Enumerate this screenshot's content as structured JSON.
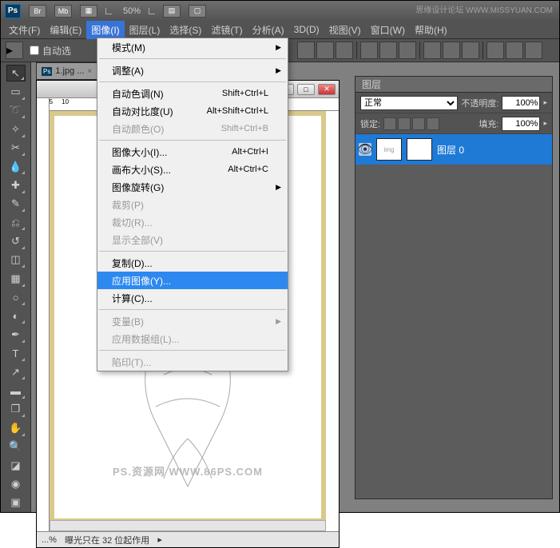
{
  "app": {
    "icon": "Ps",
    "zoom": "50%"
  },
  "watermark_top": "思缘设计论坛  WWW.MISSYUAN.COM",
  "menubar": [
    "文件(F)",
    "编辑(E)",
    "图像(I)",
    "图层(L)",
    "选择(S)",
    "滤镜(T)",
    "分析(A)",
    "3D(D)",
    "视图(V)",
    "窗口(W)",
    "帮助(H)"
  ],
  "menubar_active_index": 2,
  "optionsbar": {
    "auto_select": "自动选"
  },
  "document": {
    "tab": "1.jpg ...",
    "status_zoom": "...%",
    "status_text": "曝光只在 32 位起作用"
  },
  "canvas_watermark": "PS.资源网  WWW.86PS.COM",
  "image_menu": {
    "groups": [
      [
        {
          "label": "模式(M)",
          "submenu": true
        }
      ],
      [
        {
          "label": "调整(A)",
          "submenu": true
        }
      ],
      [
        {
          "label": "自动色调(N)",
          "shortcut": "Shift+Ctrl+L"
        },
        {
          "label": "自动对比度(U)",
          "shortcut": "Alt+Shift+Ctrl+L"
        },
        {
          "label": "自动颜色(O)",
          "shortcut": "Shift+Ctrl+B",
          "disabled": true
        }
      ],
      [
        {
          "label": "图像大小(I)...",
          "shortcut": "Alt+Ctrl+I"
        },
        {
          "label": "画布大小(S)...",
          "shortcut": "Alt+Ctrl+C"
        },
        {
          "label": "图像旋转(G)",
          "submenu": true
        },
        {
          "label": "裁剪(P)",
          "disabled": true
        },
        {
          "label": "裁切(R)...",
          "disabled": true
        },
        {
          "label": "显示全部(V)",
          "disabled": true
        }
      ],
      [
        {
          "label": "复制(D)..."
        },
        {
          "label": "应用图像(Y)...",
          "highlighted": true
        },
        {
          "label": "计算(C)..."
        }
      ],
      [
        {
          "label": "变量(B)",
          "submenu": true,
          "disabled": true
        },
        {
          "label": "应用数据组(L)...",
          "disabled": true
        }
      ],
      [
        {
          "label": "陷印(T)...",
          "disabled": true
        }
      ]
    ]
  },
  "layers_panel": {
    "title": "图层",
    "blend_mode": "正常",
    "opacity_label": "不透明度:",
    "opacity_value": "100%",
    "lock_label": "锁定:",
    "fill_label": "填充:",
    "fill_value": "100%",
    "layers": [
      {
        "name": "图层 0",
        "selected": true,
        "visible": true
      }
    ]
  },
  "tools": [
    "move",
    "marquee",
    "lasso",
    "wand",
    "crop",
    "eyedrop",
    "heal",
    "brush",
    "stamp",
    "history",
    "eraser",
    "gradient",
    "blur",
    "dodge",
    "pen",
    "type",
    "path",
    "shape",
    "3d",
    "hand",
    "zoom",
    "fg-bg",
    "quick-mask",
    "screen-mode"
  ]
}
